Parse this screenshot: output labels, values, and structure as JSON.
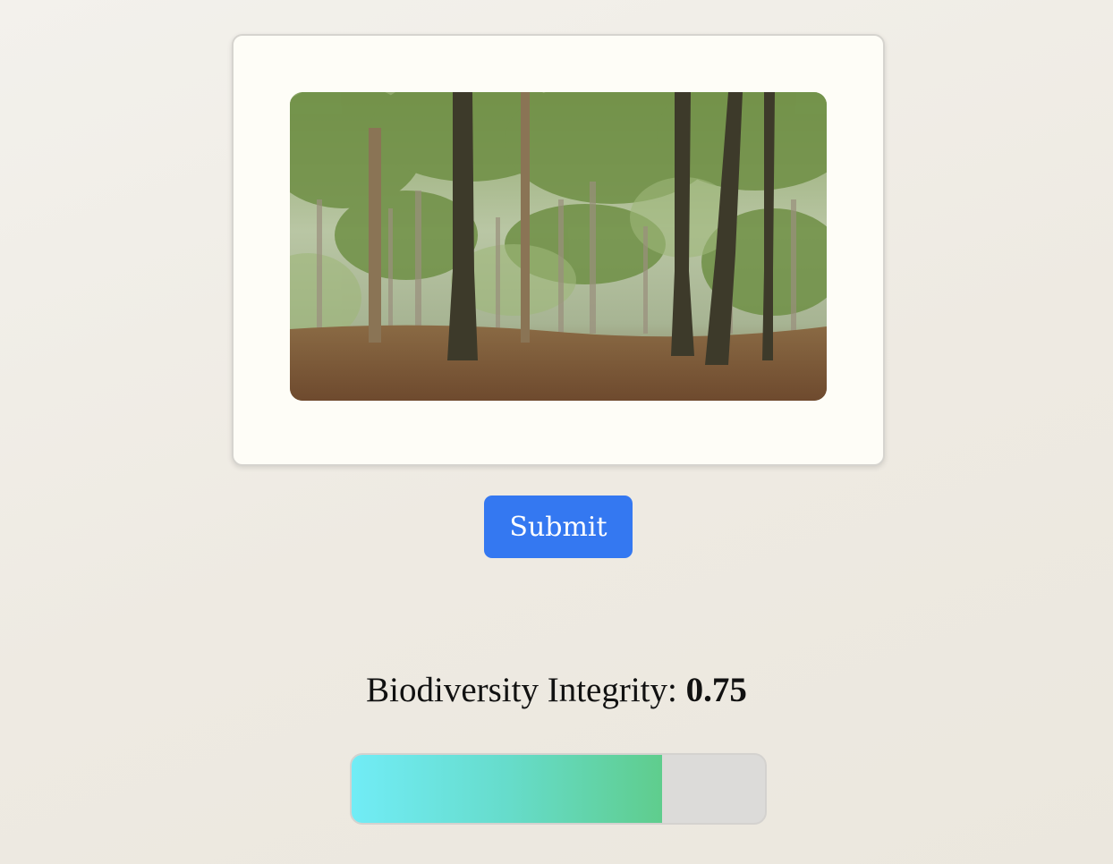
{
  "submit": {
    "label": "Submit"
  },
  "result": {
    "label": "Biodiversity Integrity: ",
    "value": "0.75",
    "progress_fraction": 0.75
  },
  "image": {
    "subject": "forest-photo"
  },
  "colors": {
    "button": "#3478f1",
    "bar_start": "#71ecf6",
    "bar_end": "#5fcd8d",
    "bar_track": "#dcdbd9"
  }
}
